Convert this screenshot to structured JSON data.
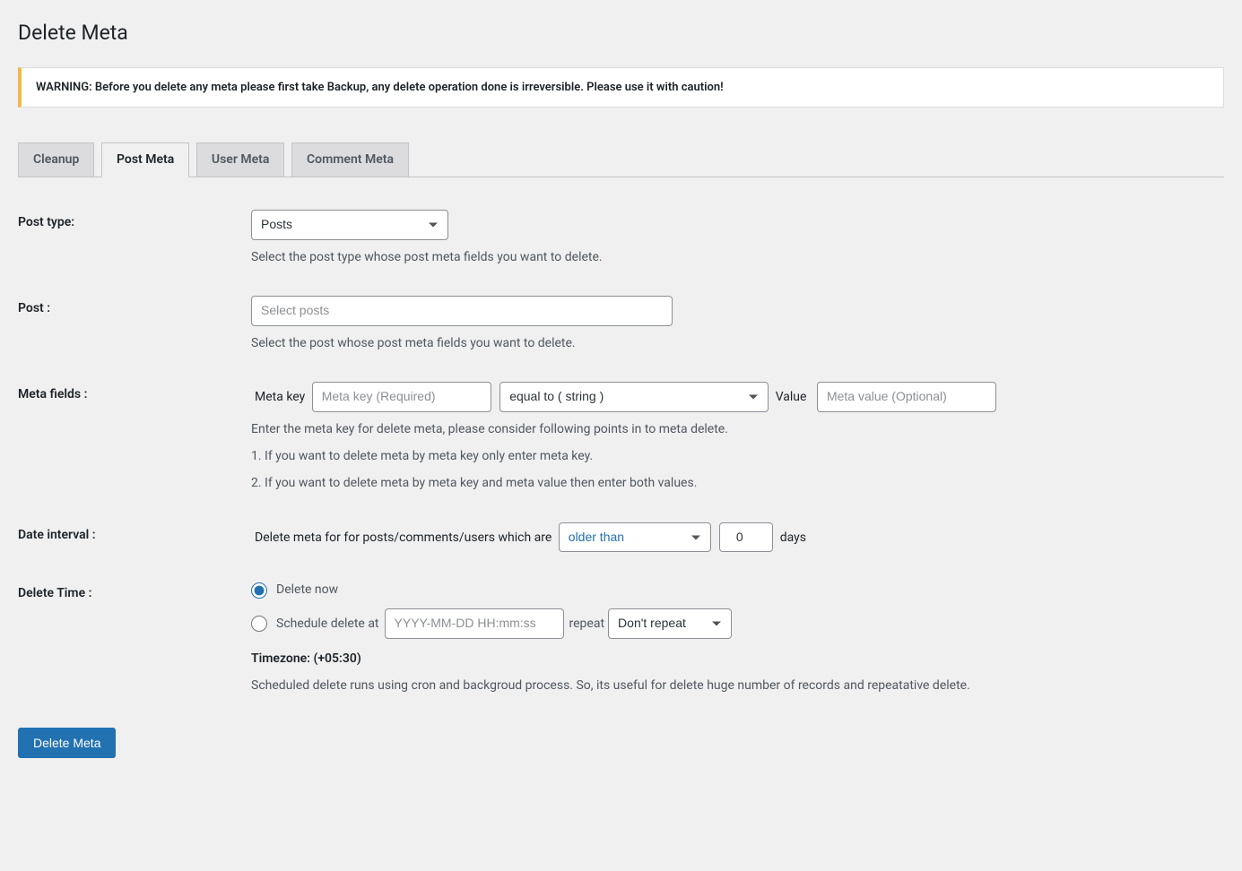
{
  "page": {
    "title": "Delete Meta"
  },
  "warning": {
    "text": "WARNING: Before you delete any meta please first take Backup, any delete operation done is irreversible. Please use it with caution!"
  },
  "tabs": {
    "cleanup": "Cleanup",
    "postmeta": "Post Meta",
    "usermeta": "User Meta",
    "commentmeta": "Comment Meta"
  },
  "form": {
    "post_type": {
      "label": "Post type:",
      "selected": "Posts",
      "description": "Select the post type whose post meta fields you want to delete."
    },
    "post": {
      "label": "Post :",
      "placeholder": "Select posts",
      "description": "Select the post whose post meta fields you want to delete."
    },
    "meta_fields": {
      "label": "Meta fields :",
      "key_label": "Meta key",
      "key_placeholder": "Meta key (Required)",
      "operator_selected": "equal to ( string )",
      "value_label": "Value",
      "value_placeholder": "Meta value (Optional)",
      "desc_line1": "Enter the meta key for delete meta, please consider following points in to meta delete.",
      "desc_line2": "1. If you want to delete meta by meta key only enter meta key.",
      "desc_line3": "2. If you want to delete meta by meta key and meta value then enter both values."
    },
    "date_interval": {
      "label": "Date interval :",
      "text": "Delete meta for for posts/comments/users which are",
      "selected": "older than",
      "days_value": "0",
      "days_label": "days"
    },
    "delete_time": {
      "label": "Delete Time :",
      "now_label": "Delete now",
      "schedule_label": "Schedule delete at",
      "schedule_placeholder": "YYYY-MM-DD HH:mm:ss",
      "repeat_label": "repeat",
      "repeat_selected": "Don't repeat",
      "timezone": "Timezone: (+05:30)",
      "desc": "Scheduled delete runs using cron and backgroud process. So, its useful for delete huge number of records and repeatative delete."
    },
    "submit": "Delete Meta"
  }
}
